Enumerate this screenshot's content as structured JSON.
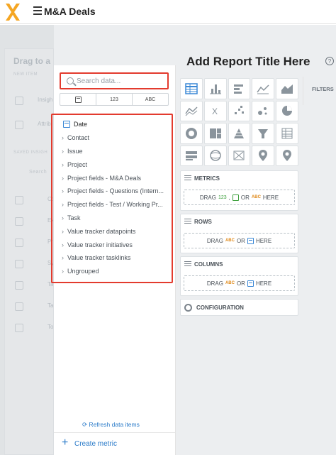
{
  "header": {
    "app_title": "M&A Deals",
    "brand_color": "#f5a623"
  },
  "left_panel": {
    "title": "Drag to a",
    "new_item": "NEW ITEM",
    "new_items": [
      "Insigh",
      "Attrib"
    ],
    "saved_items_label": "SAVED INSIGH",
    "search_placeholder": "Search",
    "saved_items": [
      "Com",
      "Exec",
      "Prop",
      "Syne",
      "Targ",
      "Task",
      "Total"
    ]
  },
  "data_panel": {
    "search_placeholder": "Search data...",
    "type_filters": [
      "",
      "123",
      "ABC"
    ],
    "fields": [
      {
        "label": "Date",
        "type": "date"
      },
      {
        "label": "Contact",
        "type": "folder"
      },
      {
        "label": "Issue",
        "type": "folder"
      },
      {
        "label": "Project",
        "type": "folder"
      },
      {
        "label": "Project fields - M&A Deals",
        "type": "folder"
      },
      {
        "label": "Project fields - Questions (Intern...",
        "type": "folder"
      },
      {
        "label": "Project fields - Test / Working Pr...",
        "type": "folder"
      },
      {
        "label": "Task",
        "type": "folder"
      },
      {
        "label": "Value tracker datapoints",
        "type": "folder"
      },
      {
        "label": "Value tracker initiatives",
        "type": "folder"
      },
      {
        "label": "Value tracker tasklinks",
        "type": "folder"
      },
      {
        "label": "Ungrouped",
        "type": "folder"
      }
    ],
    "refresh_label": "Refresh data items",
    "create_metric_label": "Create metric"
  },
  "report": {
    "title": "Add Report Title Here",
    "help": "?",
    "filters_label": "FILTERS"
  },
  "visualizations": [
    "table-icon",
    "column-chart-icon",
    "bar-chart-icon",
    "line-chart-icon",
    "area-chart-icon",
    "combo-chart-icon",
    "xirr-icon",
    "scatter-icon",
    "bubble-icon",
    "pie-icon",
    "donut-icon",
    "treemap-icon",
    "pyramid-icon",
    "funnel-icon",
    "pivot-table-icon",
    "bullet-icon",
    "sankey-icon",
    "geo-chart-icon",
    "heatmap-icon",
    "map-pin-icon"
  ],
  "zones": {
    "metrics": {
      "label": "METRICS",
      "drag": "DRAG",
      "n123": "123",
      "comma": ",",
      "or": "OR",
      "abc": "ABC",
      "here": "HERE"
    },
    "rows": {
      "label": "ROWS",
      "drag": "DRAG",
      "abc": "ABC",
      "or": "OR",
      "here": "HERE"
    },
    "columns": {
      "label": "COLUMNS",
      "drag": "DRAG",
      "abc": "ABC",
      "or": "OR",
      "here": "HERE"
    },
    "configuration": {
      "label": "CONFIGURATION"
    }
  }
}
